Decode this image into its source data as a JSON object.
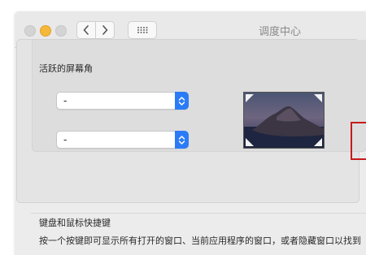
{
  "window": {
    "title": "调度中心"
  },
  "hot_corners": {
    "section_title": "活跃的屏幕角",
    "top_left_value": "-",
    "bottom_left_value": "-"
  },
  "keyboard": {
    "section_title": "键盘和鼠标快捷键",
    "description": "按一个按键即可显示所有打开的窗口、当前应用程序的窗口，或者隐藏窗口以找到"
  },
  "icons": {
    "back": "chevron-left-icon",
    "forward": "chevron-right-icon",
    "grid": "grid-icon",
    "select_arrow": "up-down-chevron-icon"
  },
  "colors": {
    "accent_blue": "#2b7bf6",
    "yellow_light": "#f6b83a",
    "highlight_red": "#c61a1a"
  }
}
